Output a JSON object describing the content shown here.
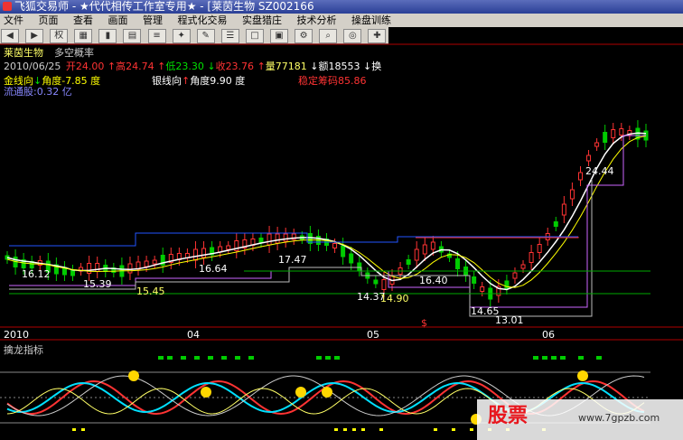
{
  "window": {
    "title": "飞狐交易师 - ★代代相传工作室专用★ - [莱茵生物 SZ002166"
  },
  "menu": [
    "文件",
    "页面",
    "查看",
    "画面",
    "管理",
    "程式化交易",
    "实盘猎庄",
    "技术分析",
    "操盘训练"
  ],
  "toolbar": {
    "items": [
      "back",
      "fwd",
      "权",
      "chart",
      "bars",
      "grid",
      "calc",
      "fire",
      "draw",
      "list",
      "win",
      "tile",
      "cfg"
    ],
    "quan_label": "权"
  },
  "stock": {
    "name": "莱茵生物",
    "indicator_name": "多空概率",
    "date": "2010/06/25",
    "open_label": "开",
    "open": "24.00",
    "high_label": "高",
    "high": "24.74",
    "low_label": "低",
    "low": "23.30",
    "close_label": "收",
    "close": "23.76",
    "vol_label": "量",
    "vol": "77181",
    "amount_label": "额",
    "amount": "18553",
    "tail": "换"
  },
  "lines": {
    "gold": "金线向",
    "gold_angle": "角度-7.85 度",
    "silver": "银线向",
    "silver_angle": "角度9.90 度",
    "stable": "稳定筹码85.86",
    "float": "流通股:0.32 亿"
  },
  "price_labels": [
    "16.12",
    "15.39",
    "15.45",
    "16.64",
    "17.47",
    "14.37",
    "14.90",
    "16.40",
    "14.65",
    "13.01",
    "24.44"
  ],
  "axis": {
    "x_labels": [
      "2010",
      "04",
      "05",
      "06"
    ],
    "marker": "$"
  },
  "lower_panel": {
    "title": "擒龙指标"
  },
  "watermark": {
    "brand": "股票",
    "url": "www.7gpzb.com"
  },
  "colors": {
    "up": "#ff3333",
    "down": "#00cc00",
    "ma_white": "#ffffff",
    "ma_yellow": "#ffff00",
    "blue": "#2255ff",
    "purple": "#cc66ff",
    "cyan": "#00e0ff"
  }
}
